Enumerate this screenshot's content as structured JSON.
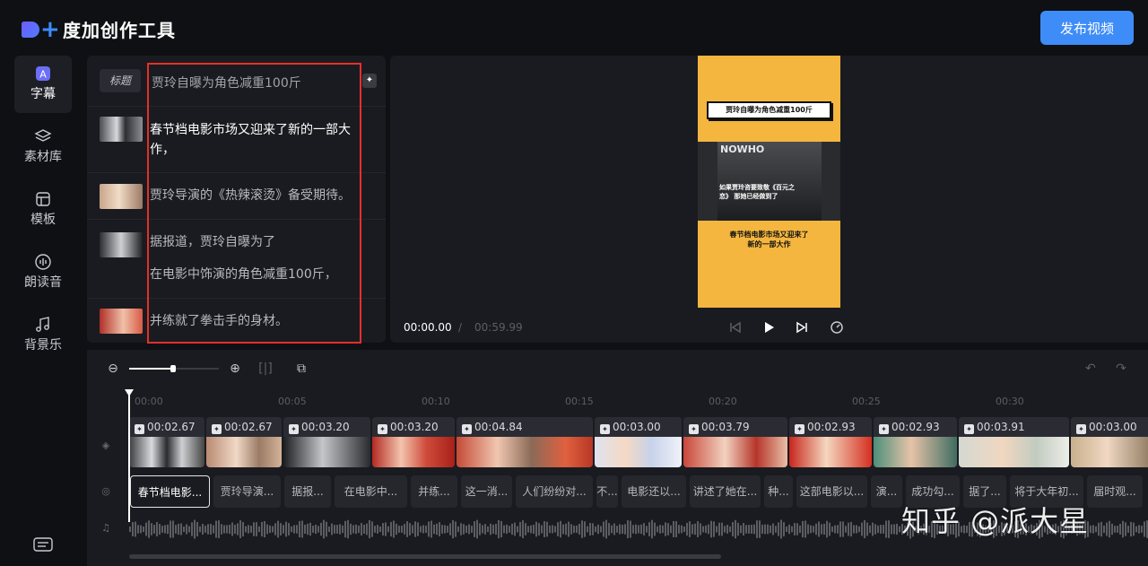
{
  "app": {
    "title": "度加创作工具",
    "publish_label": "发布视频"
  },
  "sidebar": {
    "items": [
      {
        "label": "字幕",
        "icon": "subtitle-icon",
        "active": true
      },
      {
        "label": "素材库",
        "icon": "layers-icon",
        "active": false
      },
      {
        "label": "模板",
        "icon": "template-icon",
        "active": false
      },
      {
        "label": "朗读音",
        "icon": "voice-icon",
        "active": false
      },
      {
        "label": "背景乐",
        "icon": "music-icon",
        "active": false
      }
    ]
  },
  "subtitle_panel": {
    "title_tag": "标题",
    "title_text": "贾玲自曝为角色减重100斤",
    "captions": [
      "春节档电影市场又迎来了新的一部大作，",
      "贾玲导演的《热辣滚烫》备受期待。",
      "据报道，贾玲自曝为了",
      "在电影中饰演的角色减重100斤，",
      "并练就了拳击手的身材。"
    ]
  },
  "preview": {
    "video_title": "贾玲自曝为角色减重100斤",
    "video_logo": "NOWHO",
    "video_overlay": "如果贾玲咨要致敬《百元之恋》 那她已经做到了",
    "video_caption_line1": "春节档电影市场又迎来了",
    "video_caption_line2": "新的一部大作",
    "time_current": "00:00.00",
    "time_sep": "/",
    "time_total": "00:59.99"
  },
  "timeline": {
    "ruler": [
      "00:00",
      "00:05",
      "00:10",
      "00:15",
      "00:20",
      "00:25",
      "00:30"
    ],
    "clips": [
      "00:02.67",
      "00:02.67",
      "00:03.20",
      "00:03.20",
      "00:04.84",
      "00:03.00",
      "00:03.79",
      "00:02.93",
      "00:02.93",
      "00:03.91",
      "00:03.00"
    ],
    "subs": [
      "春节档电影...",
      "贾玲导演...",
      "据报...",
      "在电影中...",
      "并练...",
      "这一消...",
      "人们纷纷对...",
      "不...",
      "电影还以...",
      "讲述了她在...",
      "种...",
      "这部电影以...",
      "演...",
      "成功勾...",
      "据了...",
      "将于大年初...",
      "届时观..."
    ]
  },
  "watermark": "知乎 @派大星",
  "colors": {
    "accent": "#3e8cf8",
    "highlight_box": "#e3302b",
    "panel": "#1a1b20",
    "bg": "#0f1014"
  }
}
